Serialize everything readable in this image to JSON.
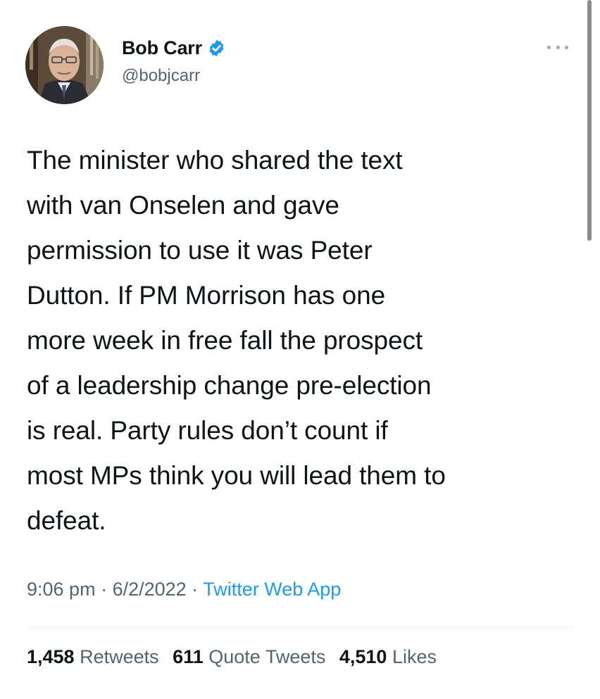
{
  "author": {
    "name": "Bob Carr",
    "handle": "@bobjcarr",
    "verified_color": "#1d9bf0"
  },
  "tweet": {
    "lines": [
      "The minister who shared the text",
      "with van Onselen and gave",
      "permission to use it was Peter",
      "Dutton. If PM Morrison has one",
      "more week in free fall the prospect",
      "of a leadership change pre-election",
      "is real. Party rules don’t count if",
      "most MPs think you will lead them to",
      "defeat."
    ]
  },
  "meta": {
    "time": "9:06 pm",
    "separator": " · ",
    "date": "6/2/2022",
    "source": "Twitter Web App"
  },
  "stats": {
    "retweets_count": "1,458",
    "retweets_label": "Retweets",
    "quotes_count": "611",
    "quotes_label": "Quote Tweets",
    "likes_count": "4,510",
    "likes_label": "Likes"
  },
  "icons": {
    "more": "more-options-icon",
    "verified": "verified-badge-icon"
  }
}
